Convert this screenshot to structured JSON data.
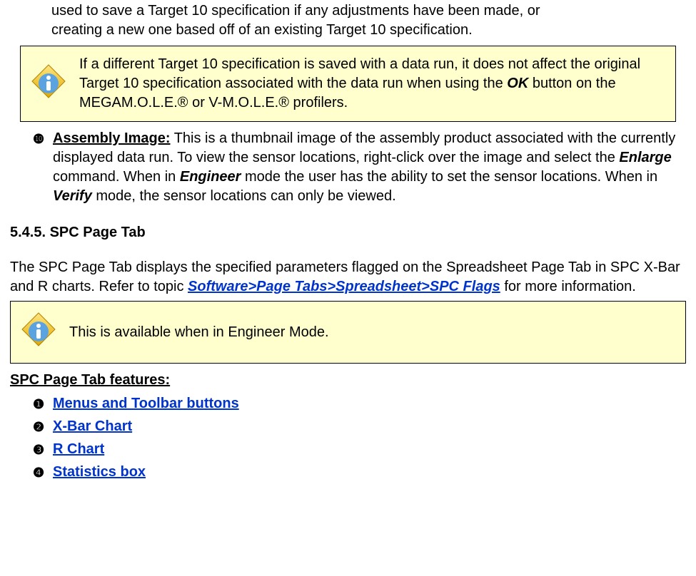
{
  "intro": {
    "line1": "used to save a Target 10 specification if any adjustments have been made, or",
    "line2": "creating a new one based off of an existing Target 10 specification."
  },
  "note1": {
    "part1": "If a different Target 10 specification is saved with a data run, it does not affect the original Target 10 specification associated with the data run when using the ",
    "ok": "OK",
    "part2": " button on the MEGAM.O.L.E.® or V-M.O.L.E.® profilers."
  },
  "bullet10": {
    "num": "❿",
    "title": "Assembly Image:",
    "text1": " This is a thumbnail image of the assembly product associated with the currently displayed data run. To view the sensor locations, right-click over the image and select the ",
    "enlarge": "Enlarge",
    "text2": " command. When in ",
    "engineer": "Engineer",
    "text3": " mode the user has the ability to set the sensor locations. When in ",
    "verify": "Verify",
    "text4": " mode, the sensor locations can only be viewed."
  },
  "section_heading": "5.4.5. SPC Page Tab",
  "spc_para": {
    "t1": "The SPC Page Tab displays the specified parameters flagged on the Spreadsheet Page Tab in SPC X-Bar and R charts. Refer to topic ",
    "link": "Software>Page Tabs>Spreadsheet>SPC Flags",
    "t2": " for more information."
  },
  "note2": "This is available when in Engineer Mode.",
  "features_heading": "SPC Page Tab features:",
  "features": [
    {
      "num": "❶",
      "label": "Menus and Toolbar buttons"
    },
    {
      "num": "❷",
      "label": "X-Bar Chart"
    },
    {
      "num": "❸",
      "label": "R Chart"
    },
    {
      "num": "❹",
      "label": "Statistics box"
    }
  ],
  "icon_name": "info-icon"
}
